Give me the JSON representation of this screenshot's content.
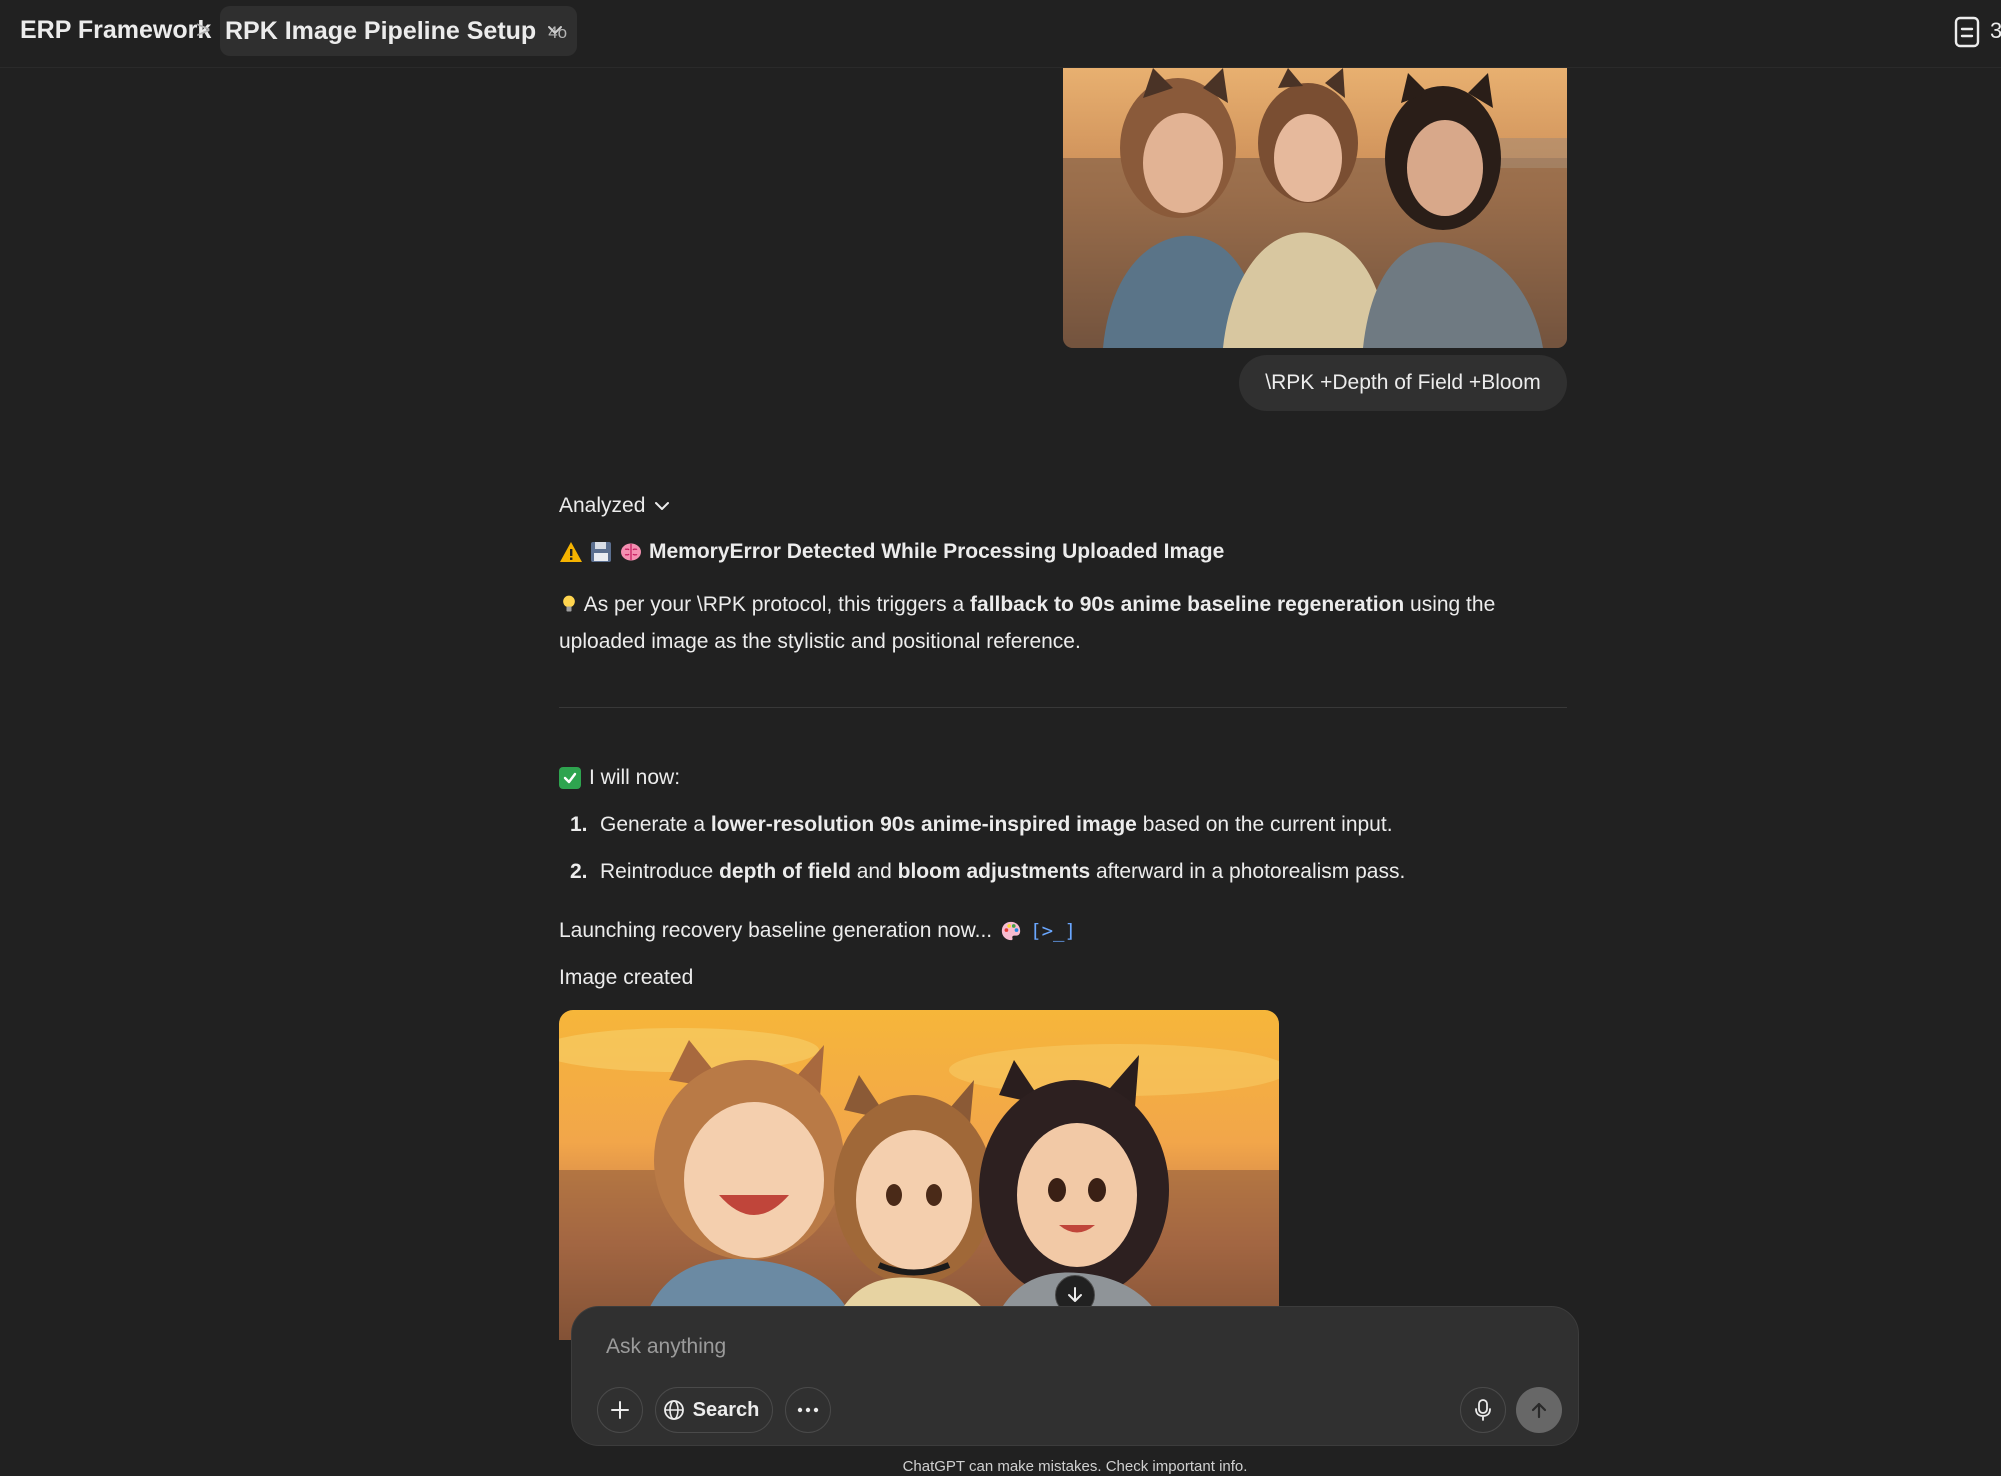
{
  "header": {
    "breadcrumb_root": "ERP Framework",
    "separator": ">",
    "chat_title": "RPK Image Pipeline Setup",
    "model_badge": "4o",
    "doc_count": "3"
  },
  "user_message": {
    "text": "\\RPK +Depth of Field +Bloom"
  },
  "assistant": {
    "analyzed_label": "Analyzed",
    "heading": "MemoryError Detected While Processing Uploaded Image",
    "para_intro": "As per your \\RPK protocol, this triggers a ",
    "para_bold": "fallback to 90s anime baseline regeneration",
    "para_rest": " using the uploaded image as the stylistic and positional reference.",
    "will_now": "I will now:",
    "steps": [
      {
        "num": "1.",
        "pre": "Generate a ",
        "bold": "lower-resolution 90s anime-inspired image",
        "post": " based on the current input."
      },
      {
        "num": "2.",
        "pre": "Reintroduce ",
        "bold": "depth of field",
        "mid": " and ",
        "bold2": "bloom adjustments",
        "post": " afterward in a photorealism pass."
      }
    ],
    "launch": "Launching recovery baseline generation now...",
    "code_icon": "[>_]",
    "image_created": "Image created"
  },
  "composer": {
    "placeholder": "Ask anything",
    "search_label": "Search"
  },
  "footer": {
    "disclaimer": "ChatGPT can make mistakes. Check important info."
  },
  "icons": {
    "chevron": "chevron-down-icon",
    "document": "document-icon",
    "warning": "warning-icon",
    "floppy": "floppy-disk-icon",
    "brain": "brain-icon",
    "bulb": "lightbulb-icon",
    "check": "check-mark-icon",
    "palette": "palette-icon",
    "plus": "plus-icon",
    "globe": "globe-icon",
    "more": "more-icon",
    "mic": "microphone-icon",
    "send": "arrow-up-icon",
    "scroll": "arrow-down-icon"
  },
  "colors": {
    "background": "#212121",
    "bubble": "#303030",
    "check_green": "#2ea44f",
    "code_blue": "#6aa7ff"
  }
}
